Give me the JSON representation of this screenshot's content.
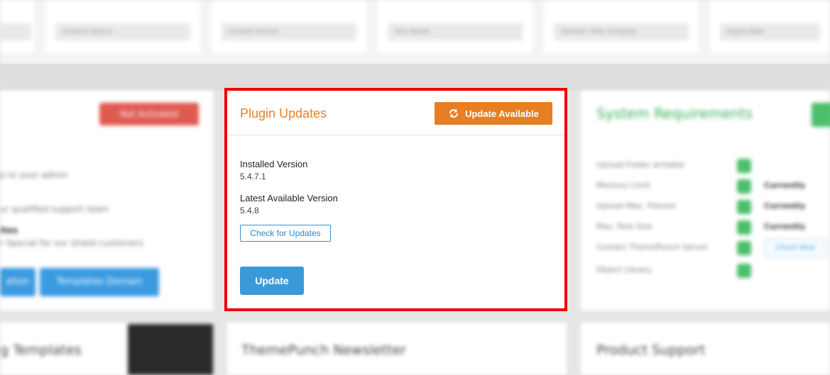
{
  "top_fields": [
    {
      "label": ""
    },
    {
      "label": "Content Source"
    },
    {
      "label": "Content Source"
    },
    {
      "label": "Your Name"
    },
    {
      "label": "Domain / Site Company"
    },
    {
      "label": "Expire Date"
    }
  ],
  "left_panel": {
    "button_label": "Not Activated",
    "lines": [
      "p to your admin",
      "ur qualified support team",
      "ites",
      "r Special for our shield customers"
    ],
    "buttons": [
      "ation",
      "Templates Domain"
    ]
  },
  "plugin_updates": {
    "title": "Plugin Updates",
    "update_available_label": "Update Available",
    "installed_label": "Installed Version",
    "installed_version": "5.4.7.1",
    "latest_label": "Latest Available Version",
    "latest_version": "5.4.8",
    "check_label": "Check for Updates",
    "update_label": "Update"
  },
  "right_panel": {
    "title": "System Requirements",
    "items": [
      "Upload Folder writable",
      "Memory Limit",
      "Upload Max. Filesize",
      "Max. Post Size",
      "Contact ThemePunch Server",
      "Object Library"
    ],
    "status_texts": [
      "",
      "Currently",
      "Currently",
      "Currently",
      "",
      ""
    ],
    "check_now_label": "Check Now"
  },
  "bottom": {
    "left_title": "g Templates",
    "mid_title": "ThemePunch Newsletter",
    "right_title": "Product Support"
  },
  "colors": {
    "highlight_border": "#ee0000",
    "title_orange": "#e5822a",
    "update_available_bg": "#e87e22",
    "primary_blue": "#3a9ad9"
  }
}
